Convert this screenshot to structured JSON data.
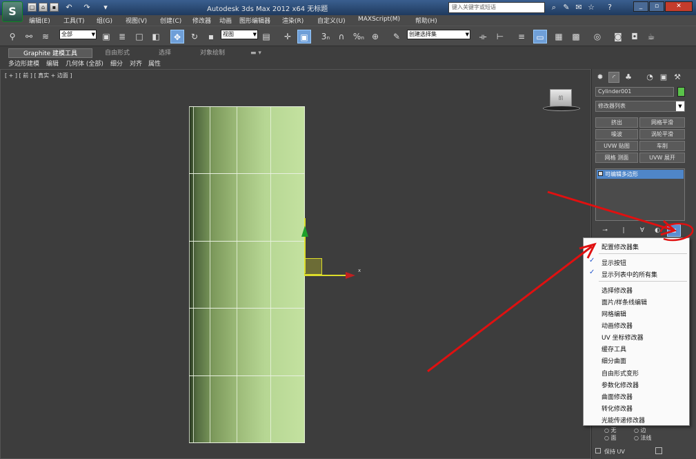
{
  "titlebar": {
    "logo_glyph": "S",
    "title": "Autodesk 3ds Max  2012 x64      无标题",
    "search_placeholder": "键入关键字或短语",
    "quick_access_icons": [
      "new-icon",
      "open-icon",
      "save-icon",
      "undo-icon",
      "redo-icon",
      "dropdown-icon"
    ]
  },
  "menubar": {
    "items": [
      "编辑(E)",
      "工具(T)",
      "组(G)",
      "视图(V)",
      "创建(C)",
      "修改器",
      "动画",
      "图形编辑器",
      "渲染(R)",
      "自定义(U)",
      "MAXScript(M)",
      "帮助(H)"
    ]
  },
  "toolbar": {
    "selection_filter": "全部",
    "reference_coord": "视图",
    "named_selection": "创建选择集"
  },
  "ribbon": {
    "tabs": [
      "Graphite 建模工具",
      "自由形式",
      "选择",
      "对象绘制"
    ],
    "subtabs": [
      "多边形建模",
      "编辑",
      "几何体 (全部)",
      "细分",
      "对齐",
      "属性"
    ]
  },
  "viewport": {
    "label": "[ + ] [ 前 ] [ 真实 + 边面 ]",
    "axis_x": "x",
    "viewcube_label": "前"
  },
  "command_panel": {
    "object_name": "Cylinder001",
    "object_color": "#5ac34a",
    "modifier_list": "修改器列表",
    "modifier_buttons": [
      "挤出",
      "网格平滑",
      "噪波",
      "涡轮平滑",
      "UVW 贴图",
      "车削",
      "网格 测面",
      "UVW 展开"
    ],
    "stack_item": "可编辑多边形",
    "selection_row1": [
      "无",
      "边"
    ],
    "selection_row2": [
      "面",
      "法线"
    ],
    "keep_uv": "保持 UV"
  },
  "context_menu": {
    "title": "配置修改器集",
    "checked_items": [
      "显示按钮",
      "显示列表中的所有集"
    ],
    "items": [
      "选择修改器",
      "面片/样条线编辑",
      "网格编辑",
      "动画修改器",
      "UV 坐标修改器",
      "缓存工具",
      "细分曲面",
      "自由形式变形",
      "参数化修改器",
      "曲面修改器",
      "转化修改器",
      "光能传递修改器"
    ]
  },
  "colors": {
    "annotation": "#e01010",
    "selection_blue": "#4f86c8",
    "cylinder_light": "#c4e2a0"
  }
}
